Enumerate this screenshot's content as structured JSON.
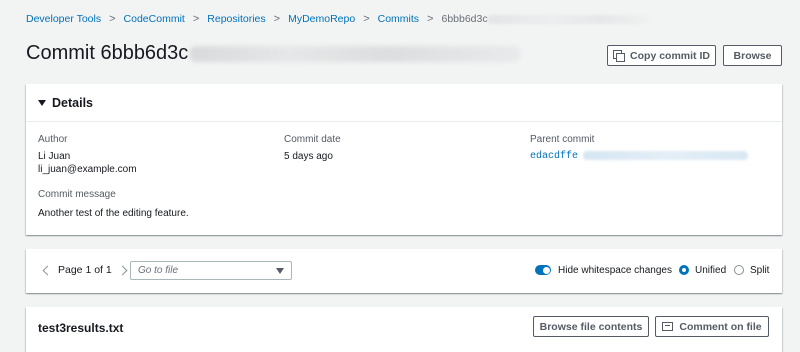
{
  "breadcrumb": {
    "items": [
      "Developer Tools",
      "CodeCommit",
      "Repositories",
      "MyDemoRepo",
      "Commits"
    ],
    "current": "6bbb6d3c"
  },
  "page": {
    "title": "Commit 6bbb6d3c",
    "copy_button": "Copy commit ID",
    "browse_button": "Browse"
  },
  "details": {
    "heading": "Details",
    "author_label": "Author",
    "author_name": "Li Juan",
    "author_email": "li_juan@example.com",
    "date_label": "Commit date",
    "date_value": "5 days ago",
    "parent_label": "Parent commit",
    "parent_value": "edacdffe",
    "message_label": "Commit message",
    "message_value": "Another test of the editing feature."
  },
  "toolbar": {
    "pager": "Page 1 of 1",
    "go_to_file_placeholder": "Go to file",
    "whitespace_label": "Hide whitespace changes",
    "whitespace_on": true,
    "unified_label": "Unified",
    "split_label": "Split",
    "view_mode": "Unified"
  },
  "file": {
    "name": "test3results.txt",
    "browse_button": "Browse file contents",
    "comment_button": "Comment on file"
  },
  "colors": {
    "link": "#0073bb",
    "background": "#f2f3f3",
    "button_border": "#545b64"
  }
}
